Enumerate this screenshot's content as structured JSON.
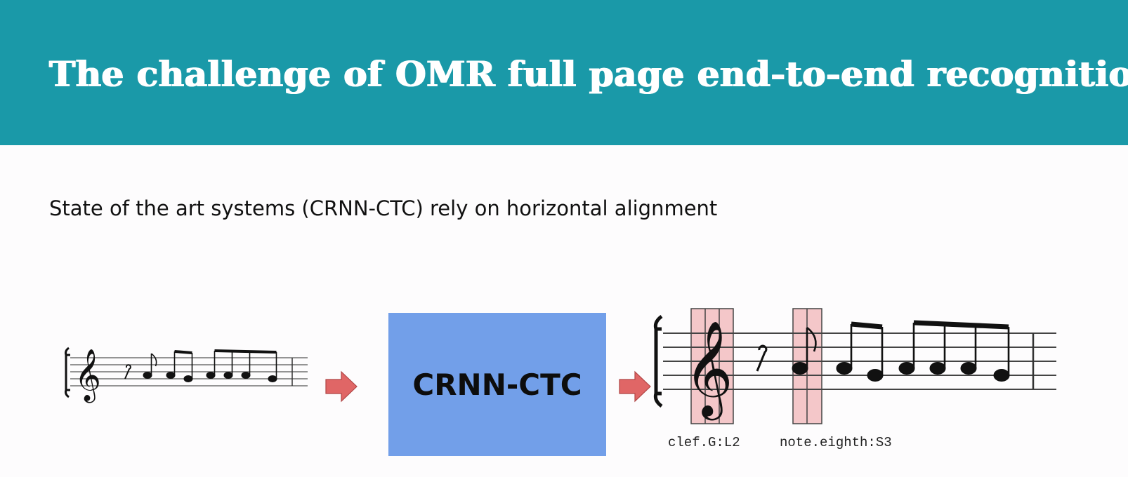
{
  "slide": {
    "title": "The challenge of OMR full page end-to-end recognition",
    "subtitle": "State of the art systems (CRNN-CTC) rely on horizontal alignment"
  },
  "model_box": {
    "label": "CRNN-CTC",
    "color": "#729fe9"
  },
  "output_tokens": [
    "clef.G:L2",
    "note.eighth:S3"
  ],
  "colors": {
    "header": "#1a99a8",
    "arrow": "#e06666",
    "highlight": "#f4c7c9"
  }
}
